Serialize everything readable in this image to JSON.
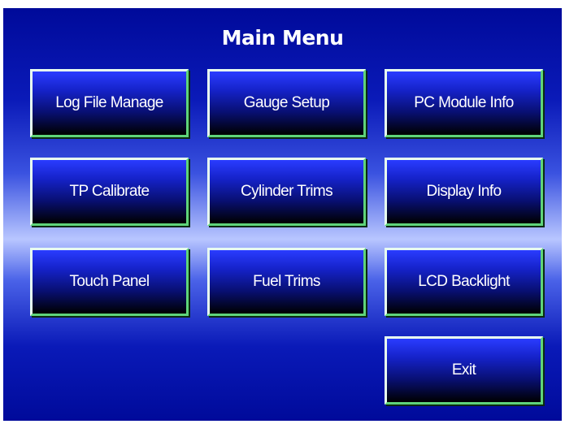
{
  "title": "Main Menu",
  "buttons": {
    "log_file_manage": "Log File Manage",
    "gauge_setup": "Gauge Setup",
    "pc_module_info": "PC Module Info",
    "tp_calibrate": "TP Calibrate",
    "cylinder_trims": "Cylinder Trims",
    "display_info": "Display Info",
    "touch_panel": "Touch Panel",
    "fuel_trims": "Fuel Trims",
    "lcd_backlight": "LCD Backlight",
    "exit": "Exit"
  },
  "colors": {
    "background": "#0a1ab8",
    "button_face": "#080f70",
    "button_border": "#5fd47a",
    "text": "#ffffff"
  }
}
